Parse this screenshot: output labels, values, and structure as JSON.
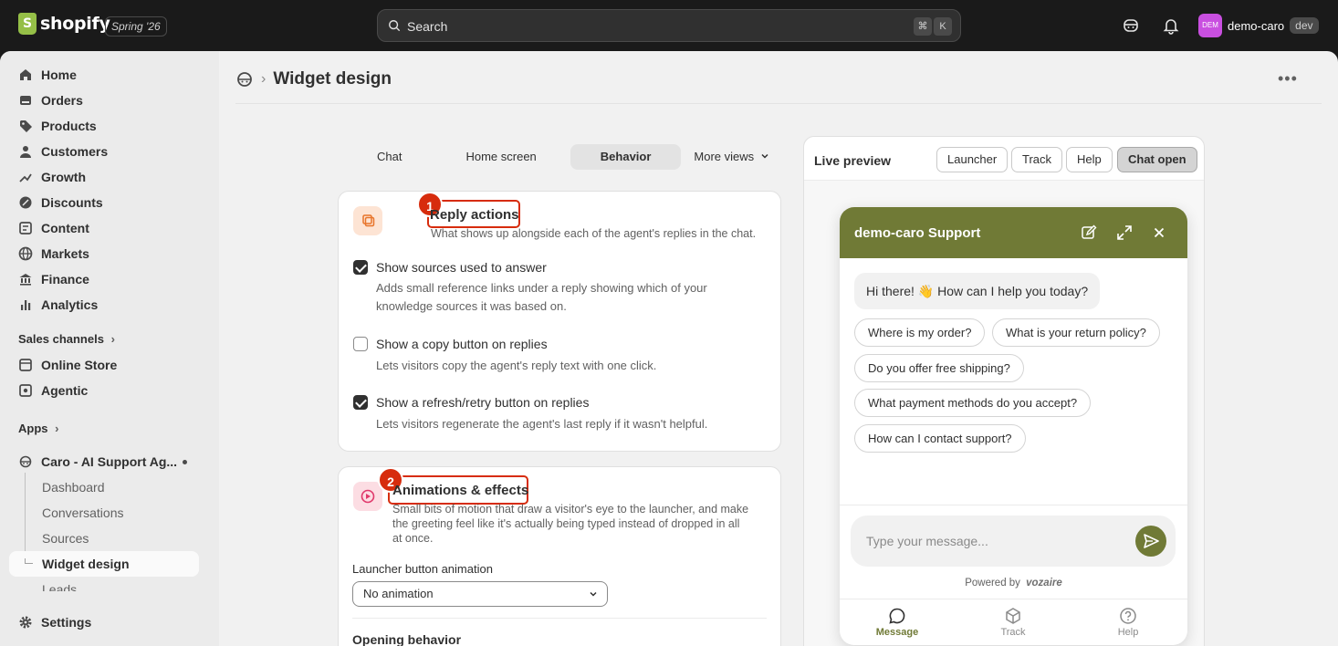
{
  "topbar": {
    "brand": "shopify",
    "edition": "Spring '26",
    "search_placeholder": "Search",
    "shortcut_mod": "⌘",
    "shortcut_key": "K",
    "account_initials": "DEM",
    "account_name": "demo-caro",
    "account_badge": "dev"
  },
  "sidebar": {
    "items": [
      {
        "label": "Home",
        "icon": "home-icon"
      },
      {
        "label": "Orders",
        "icon": "orders-icon"
      },
      {
        "label": "Products",
        "icon": "tag-icon"
      },
      {
        "label": "Customers",
        "icon": "person-icon"
      },
      {
        "label": "Growth",
        "icon": "growth-icon"
      },
      {
        "label": "Discounts",
        "icon": "discount-icon"
      },
      {
        "label": "Content",
        "icon": "content-icon"
      },
      {
        "label": "Markets",
        "icon": "globe-icon"
      },
      {
        "label": "Finance",
        "icon": "bank-icon"
      },
      {
        "label": "Analytics",
        "icon": "chart-icon"
      }
    ],
    "sales_channels_label": "Sales channels",
    "channels": [
      {
        "label": "Online Store",
        "icon": "store-icon"
      },
      {
        "label": "Agentic",
        "icon": "agentic-icon"
      }
    ],
    "apps_label": "Apps",
    "app_name": "Caro - AI Support Ag...",
    "app_subitems": [
      "Dashboard",
      "Conversations",
      "Sources",
      "Widget design",
      "Leads"
    ],
    "settings_label": "Settings"
  },
  "page": {
    "title": "Widget design",
    "tabs": [
      "Chat",
      "Home screen",
      "Behavior",
      "More views"
    ],
    "selected_tab": "Behavior"
  },
  "reply_actions": {
    "marker": "1",
    "title": "Reply actions",
    "description": "What shows up alongside each of the agent's replies in the chat.",
    "options": [
      {
        "label": "Show sources used to answer",
        "help_line1": "Adds small reference links under a reply showing which of your",
        "help_line2": "knowledge sources it was based on.",
        "checked": true
      },
      {
        "label": "Show a copy button on replies",
        "help_line1": "Lets visitors copy the agent's reply text with one click.",
        "help_line2": "",
        "checked": false
      },
      {
        "label": "Show a refresh/retry button on replies",
        "help_line1": "Lets visitors regenerate the agent's last reply if it wasn't helpful.",
        "help_line2": "",
        "checked": true
      }
    ]
  },
  "animations": {
    "marker": "2",
    "title": "Animations & effects",
    "desc_line1": "Small bits of motion that draw a visitor's eye to the launcher, and make",
    "desc_line2": "the greeting feel like it's actually being typed instead of dropped in all",
    "desc_line3": "at once.",
    "launcher_label": "Launcher button animation",
    "launcher_value": "No animation",
    "opening_label": "Opening behavior"
  },
  "preview": {
    "title": "Live preview",
    "buttons": [
      "Launcher",
      "Track",
      "Help",
      "Chat open"
    ],
    "selected": "Chat open",
    "chat_title": "demo-caro Support",
    "greeting": "Hi there! 👋 How can I help you today?",
    "suggestions": [
      "Where is my order?",
      "What is your return policy?",
      "Do you offer free shipping?",
      "What payment methods do you accept?",
      "How can I contact support?"
    ],
    "input_placeholder": "Type your message...",
    "powered_by": "Powered by",
    "powered_brand": "vozaire",
    "nav": [
      "Message",
      "Track",
      "Help"
    ],
    "accent_color": "#707a36"
  }
}
